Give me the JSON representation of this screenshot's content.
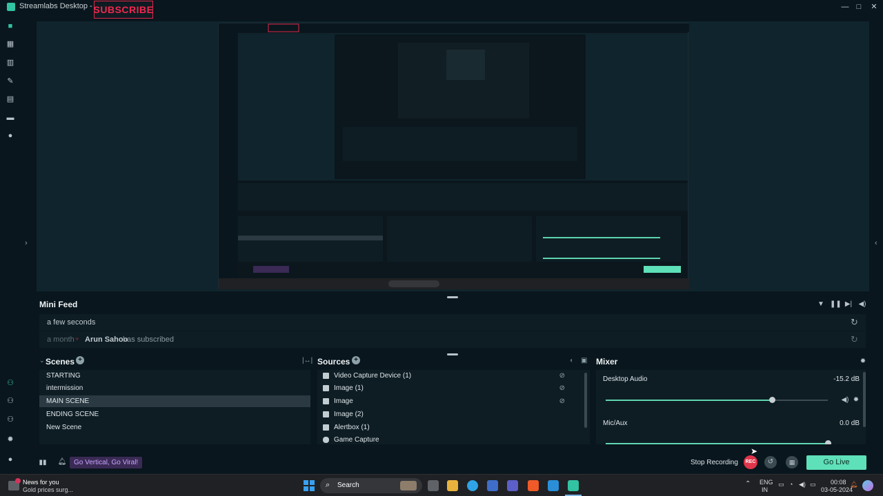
{
  "window": {
    "title": "Streamlabs Desktop - 1.16",
    "overlay_subscribe": "SUBSCRIBE",
    "minimize": "—",
    "maximize": "□",
    "close": "✕"
  },
  "nav": {
    "top_icons": [
      "editor-icon",
      "dashboard-icon",
      "layout-icon",
      "themes-icon",
      "store-icon",
      "recordings-icon",
      "highlighter-icon"
    ],
    "bottom_icons": [
      "collab-icon",
      "share-icon",
      "settings-gear-icon",
      "settings-icon",
      "profile-icon"
    ]
  },
  "minifeed": {
    "title": "Mini Feed",
    "row1": "a few seconds",
    "row2_time": "a month",
    "row2_user": "Arun Sahoo",
    "row2_action": "has subscribed"
  },
  "scenes": {
    "title": "Scenes",
    "items": [
      "STARTING",
      "intermission",
      "MAIN SCENE",
      "ENDING SCENE",
      "New Scene"
    ],
    "selected_index": 2
  },
  "sources": {
    "title": "Sources",
    "items": [
      "Video Capture Device (1)",
      "Image (1)",
      "Image",
      "Image (2)",
      "Alertbox (1)",
      "Game Capture"
    ]
  },
  "mixer": {
    "title": "Mixer",
    "channels": [
      {
        "name": "Desktop Audio",
        "db": "-15.2 dB",
        "level": 0.75
      },
      {
        "name": "Mic/Aux",
        "db": "0.0 dB",
        "level": 1.0
      }
    ]
  },
  "footer": {
    "promo": "Go Vertical, Go Viral!",
    "stop_recording": "Stop Recording",
    "rec_badge": "REC",
    "go_live": "Go Live"
  },
  "taskbar": {
    "news_title": "News for you",
    "news_sub": "Gold prices surg...",
    "search": "Search",
    "lang_top": "ENG",
    "lang_bottom": "IN",
    "time": "00:08",
    "date": "03-05-2024"
  },
  "colors": {
    "accent": "#31c3a2",
    "go_live": "#5ee0b8",
    "rec": "#e0344a",
    "promo_bg": "#3a2a55",
    "promo_text": "#c9a6ff"
  }
}
